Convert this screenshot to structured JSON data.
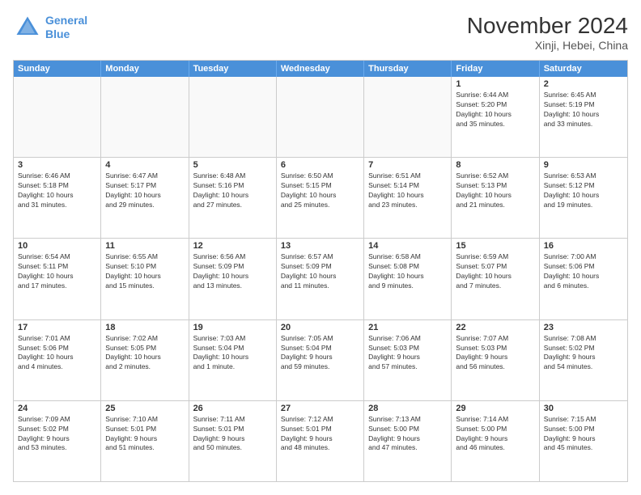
{
  "logo": {
    "line1": "General",
    "line2": "Blue"
  },
  "title": "November 2024",
  "location": "Xinji, Hebei, China",
  "header": {
    "days": [
      "Sunday",
      "Monday",
      "Tuesday",
      "Wednesday",
      "Thursday",
      "Friday",
      "Saturday"
    ]
  },
  "rows": [
    [
      {
        "day": "",
        "info": "",
        "empty": true
      },
      {
        "day": "",
        "info": "",
        "empty": true
      },
      {
        "day": "",
        "info": "",
        "empty": true
      },
      {
        "day": "",
        "info": "",
        "empty": true
      },
      {
        "day": "",
        "info": "",
        "empty": true
      },
      {
        "day": "1",
        "info": "Sunrise: 6:44 AM\nSunset: 5:20 PM\nDaylight: 10 hours\nand 35 minutes.",
        "empty": false
      },
      {
        "day": "2",
        "info": "Sunrise: 6:45 AM\nSunset: 5:19 PM\nDaylight: 10 hours\nand 33 minutes.",
        "empty": false
      }
    ],
    [
      {
        "day": "3",
        "info": "Sunrise: 6:46 AM\nSunset: 5:18 PM\nDaylight: 10 hours\nand 31 minutes.",
        "empty": false
      },
      {
        "day": "4",
        "info": "Sunrise: 6:47 AM\nSunset: 5:17 PM\nDaylight: 10 hours\nand 29 minutes.",
        "empty": false
      },
      {
        "day": "5",
        "info": "Sunrise: 6:48 AM\nSunset: 5:16 PM\nDaylight: 10 hours\nand 27 minutes.",
        "empty": false
      },
      {
        "day": "6",
        "info": "Sunrise: 6:50 AM\nSunset: 5:15 PM\nDaylight: 10 hours\nand 25 minutes.",
        "empty": false
      },
      {
        "day": "7",
        "info": "Sunrise: 6:51 AM\nSunset: 5:14 PM\nDaylight: 10 hours\nand 23 minutes.",
        "empty": false
      },
      {
        "day": "8",
        "info": "Sunrise: 6:52 AM\nSunset: 5:13 PM\nDaylight: 10 hours\nand 21 minutes.",
        "empty": false
      },
      {
        "day": "9",
        "info": "Sunrise: 6:53 AM\nSunset: 5:12 PM\nDaylight: 10 hours\nand 19 minutes.",
        "empty": false
      }
    ],
    [
      {
        "day": "10",
        "info": "Sunrise: 6:54 AM\nSunset: 5:11 PM\nDaylight: 10 hours\nand 17 minutes.",
        "empty": false
      },
      {
        "day": "11",
        "info": "Sunrise: 6:55 AM\nSunset: 5:10 PM\nDaylight: 10 hours\nand 15 minutes.",
        "empty": false
      },
      {
        "day": "12",
        "info": "Sunrise: 6:56 AM\nSunset: 5:09 PM\nDaylight: 10 hours\nand 13 minutes.",
        "empty": false
      },
      {
        "day": "13",
        "info": "Sunrise: 6:57 AM\nSunset: 5:09 PM\nDaylight: 10 hours\nand 11 minutes.",
        "empty": false
      },
      {
        "day": "14",
        "info": "Sunrise: 6:58 AM\nSunset: 5:08 PM\nDaylight: 10 hours\nand 9 minutes.",
        "empty": false
      },
      {
        "day": "15",
        "info": "Sunrise: 6:59 AM\nSunset: 5:07 PM\nDaylight: 10 hours\nand 7 minutes.",
        "empty": false
      },
      {
        "day": "16",
        "info": "Sunrise: 7:00 AM\nSunset: 5:06 PM\nDaylight: 10 hours\nand 6 minutes.",
        "empty": false
      }
    ],
    [
      {
        "day": "17",
        "info": "Sunrise: 7:01 AM\nSunset: 5:06 PM\nDaylight: 10 hours\nand 4 minutes.",
        "empty": false
      },
      {
        "day": "18",
        "info": "Sunrise: 7:02 AM\nSunset: 5:05 PM\nDaylight: 10 hours\nand 2 minutes.",
        "empty": false
      },
      {
        "day": "19",
        "info": "Sunrise: 7:03 AM\nSunset: 5:04 PM\nDaylight: 10 hours\nand 1 minute.",
        "empty": false
      },
      {
        "day": "20",
        "info": "Sunrise: 7:05 AM\nSunset: 5:04 PM\nDaylight: 9 hours\nand 59 minutes.",
        "empty": false
      },
      {
        "day": "21",
        "info": "Sunrise: 7:06 AM\nSunset: 5:03 PM\nDaylight: 9 hours\nand 57 minutes.",
        "empty": false
      },
      {
        "day": "22",
        "info": "Sunrise: 7:07 AM\nSunset: 5:03 PM\nDaylight: 9 hours\nand 56 minutes.",
        "empty": false
      },
      {
        "day": "23",
        "info": "Sunrise: 7:08 AM\nSunset: 5:02 PM\nDaylight: 9 hours\nand 54 minutes.",
        "empty": false
      }
    ],
    [
      {
        "day": "24",
        "info": "Sunrise: 7:09 AM\nSunset: 5:02 PM\nDaylight: 9 hours\nand 53 minutes.",
        "empty": false
      },
      {
        "day": "25",
        "info": "Sunrise: 7:10 AM\nSunset: 5:01 PM\nDaylight: 9 hours\nand 51 minutes.",
        "empty": false
      },
      {
        "day": "26",
        "info": "Sunrise: 7:11 AM\nSunset: 5:01 PM\nDaylight: 9 hours\nand 50 minutes.",
        "empty": false
      },
      {
        "day": "27",
        "info": "Sunrise: 7:12 AM\nSunset: 5:01 PM\nDaylight: 9 hours\nand 48 minutes.",
        "empty": false
      },
      {
        "day": "28",
        "info": "Sunrise: 7:13 AM\nSunset: 5:00 PM\nDaylight: 9 hours\nand 47 minutes.",
        "empty": false
      },
      {
        "day": "29",
        "info": "Sunrise: 7:14 AM\nSunset: 5:00 PM\nDaylight: 9 hours\nand 46 minutes.",
        "empty": false
      },
      {
        "day": "30",
        "info": "Sunrise: 7:15 AM\nSunset: 5:00 PM\nDaylight: 9 hours\nand 45 minutes.",
        "empty": false
      }
    ]
  ]
}
